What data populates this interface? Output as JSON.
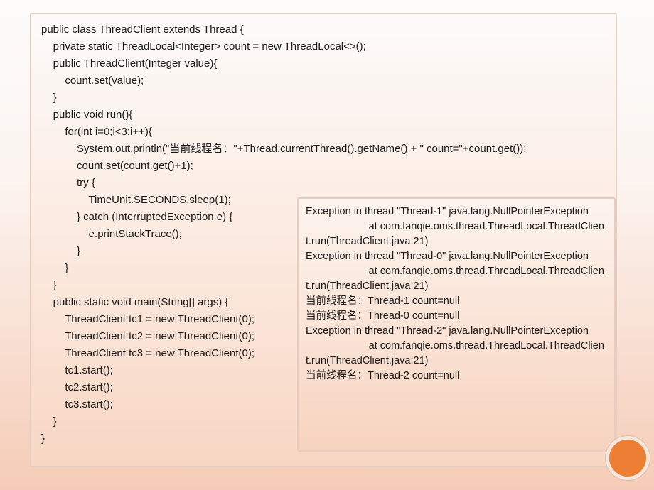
{
  "code": {
    "lines": [
      "public class ThreadClient extends Thread {",
      "    private static ThreadLocal<Integer> count = new ThreadLocal<>();",
      "    public ThreadClient(Integer value){",
      "        count.set(value);",
      "    }",
      "    public void run(){",
      "        for(int i=0;i<3;i++){",
      "            System.out.println(\"当前线程名：\"+Thread.currentThread().getName() + \" count=\"+count.get());",
      "            count.set(count.get()+1);",
      "            try {",
      "                TimeUnit.SECONDS.sleep(1);",
      "            } catch (InterruptedException e) {",
      "                e.printStackTrace();",
      "            }",
      "        }",
      "    }",
      "    public static void main(String[] args) {",
      "        ThreadClient tc1 = new ThreadClient(0);",
      "        ThreadClient tc2 = new ThreadClient(0);",
      "        ThreadClient tc3 = new ThreadClient(0);",
      "        tc1.start();",
      "        tc2.start();",
      "        tc3.start();",
      "    }",
      "}"
    ]
  },
  "output": {
    "lines": [
      "Exception in thread \"Thread-1\" java.lang.NullPointerException",
      "                      at com.fanqie.oms.thread.ThreadLocal.ThreadClient.run(ThreadClient.java:21)",
      "Exception in thread \"Thread-0\" java.lang.NullPointerException",
      "                      at com.fanqie.oms.thread.ThreadLocal.ThreadClient.run(ThreadClient.java:21)",
      "当前线程名：Thread-1 count=null",
      "当前线程名：Thread-0 count=null",
      "Exception in thread \"Thread-2\" java.lang.NullPointerException",
      "                      at com.fanqie.oms.thread.ThreadLocal.ThreadClient.run(ThreadClient.java:21)",
      "当前线程名：Thread-2 count=null"
    ]
  }
}
